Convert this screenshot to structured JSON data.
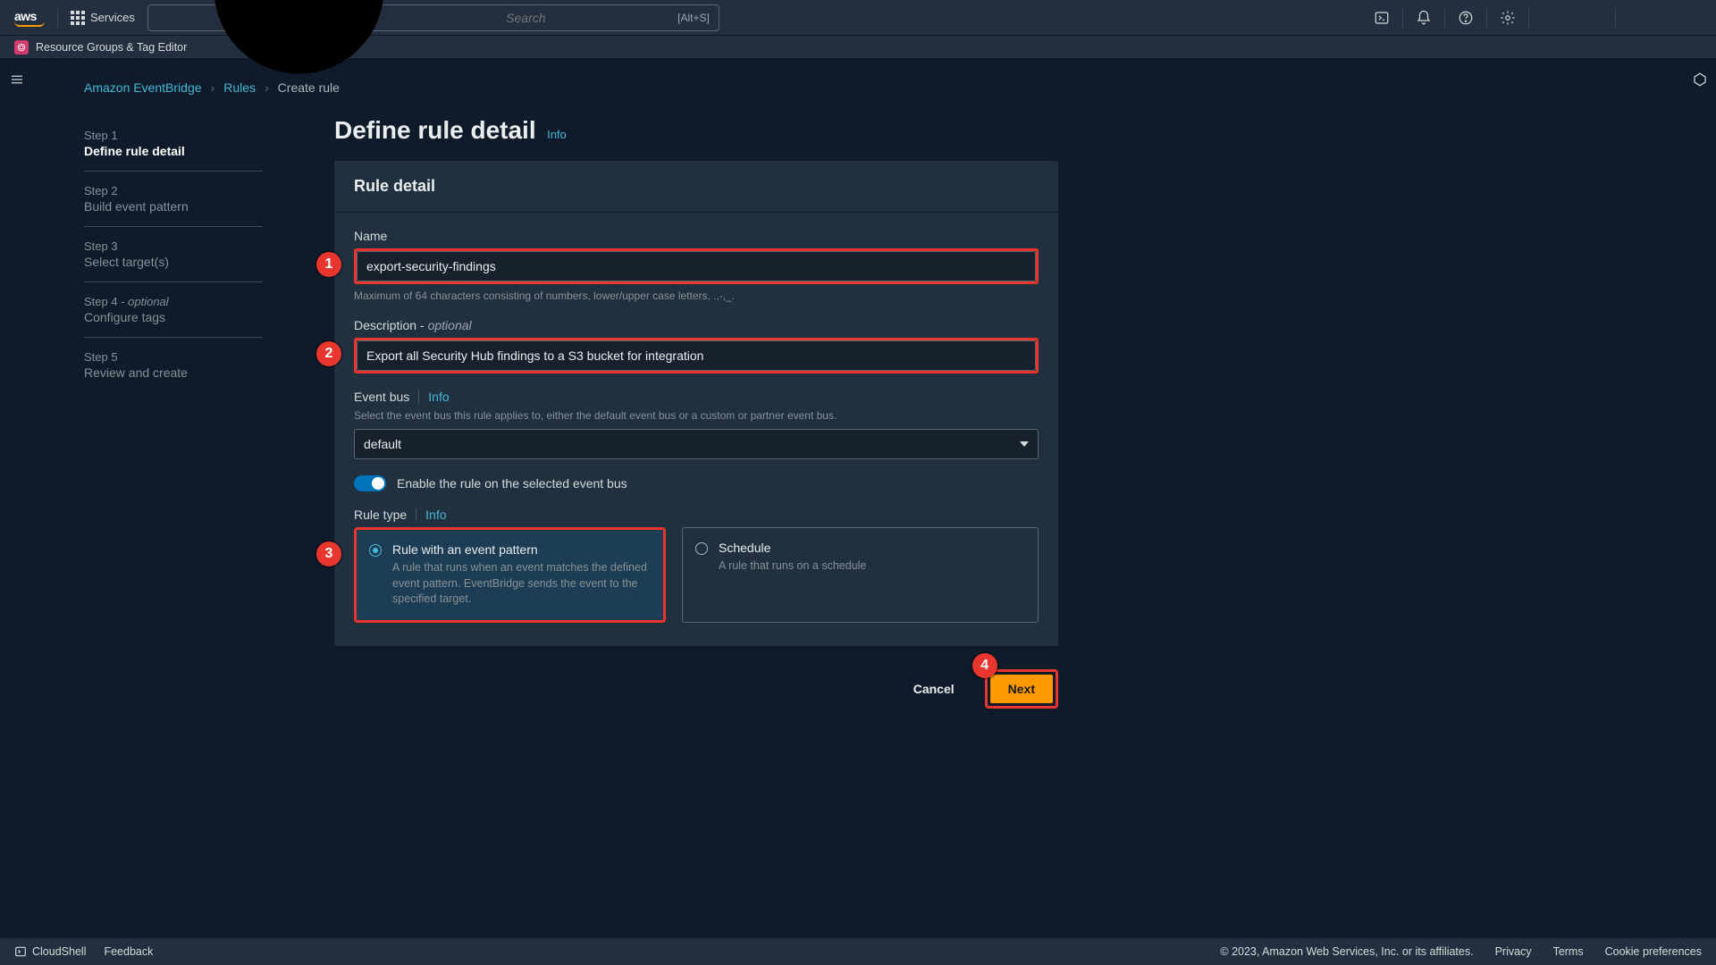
{
  "header": {
    "logo_text": "aws",
    "services_label": "Services",
    "search_placeholder": "Search",
    "search_shortcut": "[Alt+S]"
  },
  "favorites": {
    "item1": "Resource Groups & Tag Editor"
  },
  "breadcrumb": {
    "l1": "Amazon EventBridge",
    "l2": "Rules",
    "l3": "Create rule"
  },
  "steps": [
    {
      "num": "Step 1",
      "label": "Define rule detail"
    },
    {
      "num": "Step 2",
      "label": "Build event pattern"
    },
    {
      "num": "Step 3",
      "label": "Select target(s)"
    },
    {
      "num": "Step 4 - ",
      "optional": "optional",
      "label": "Configure tags"
    },
    {
      "num": "Step 5",
      "label": "Review and create"
    }
  ],
  "page": {
    "title": "Define rule detail",
    "info": "Info"
  },
  "panel": {
    "title": "Rule detail",
    "name_label": "Name",
    "name_value": "export-security-findings",
    "name_hint": "Maximum of 64 characters consisting of numbers, lower/upper case letters, .,-,_.",
    "desc_label": "Description - ",
    "desc_optional": "optional",
    "desc_value": "Export all Security Hub findings to a S3 bucket for integration",
    "bus_label": "Event bus",
    "bus_info": "Info",
    "bus_hint": "Select the event bus this rule applies to, either the default event bus or a custom or partner event bus.",
    "bus_value": "default",
    "toggle_label": "Enable the rule on the selected event bus",
    "ruletype_label": "Rule type",
    "ruletype_info": "Info",
    "opt1_title": "Rule with an event pattern",
    "opt1_desc": "A rule that runs when an event matches the defined event pattern. EventBridge sends the event to the specified target.",
    "opt2_title": "Schedule",
    "opt2_desc": "A rule that runs on a schedule"
  },
  "actions": {
    "cancel": "Cancel",
    "next": "Next"
  },
  "footer": {
    "cloudshell": "CloudShell",
    "feedback": "Feedback",
    "copyright": "© 2023, Amazon Web Services, Inc. or its affiliates.",
    "privacy": "Privacy",
    "terms": "Terms",
    "cookies": "Cookie preferences"
  }
}
